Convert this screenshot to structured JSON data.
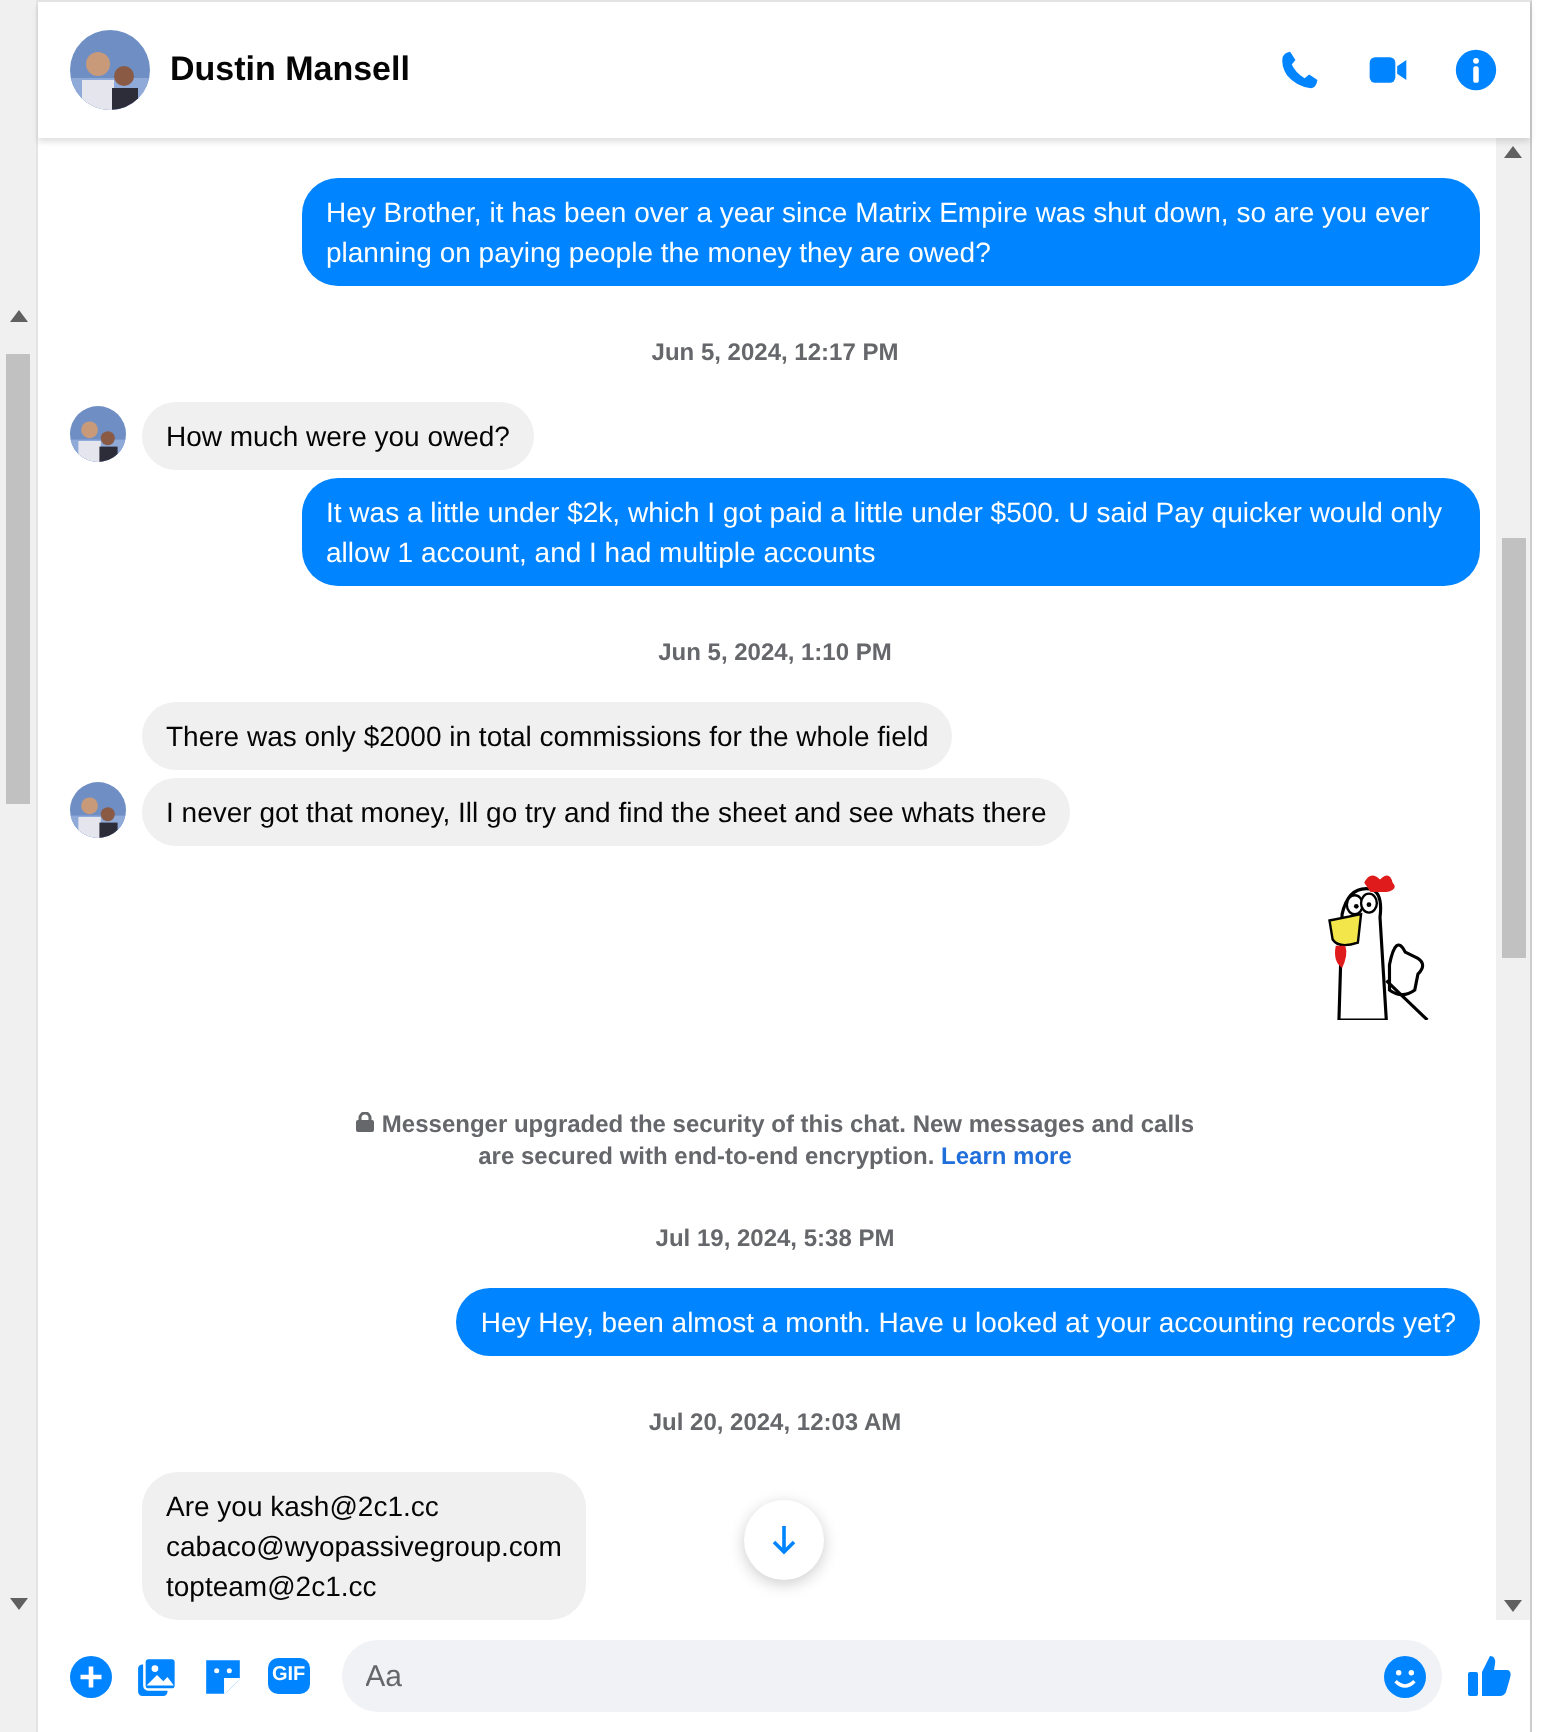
{
  "header": {
    "name": "Dustin Mansell"
  },
  "messages": [
    {
      "kind": "out",
      "text": "Hey Brother, it has been over a year since Matrix Empire was shut down, so are you ever planning on paying people the money they are owed?"
    },
    {
      "kind": "time",
      "text": "Jun 5, 2024, 12:17 PM"
    },
    {
      "kind": "in",
      "text": "How much were you owed?",
      "avatar": true
    },
    {
      "kind": "out",
      "text": "It was a little under $2k, which I got paid a little under $500. U said Pay quicker would only allow 1 account, and I had multiple accounts"
    },
    {
      "kind": "time",
      "text": "Jun 5, 2024, 1:10 PM"
    },
    {
      "kind": "in",
      "text": "There was only $2000 in total commissions for the whole field",
      "avatar": false
    },
    {
      "kind": "in",
      "text": "I never got that money, Ill go try and find the sheet and see whats there",
      "avatar": true
    },
    {
      "kind": "sticker"
    },
    {
      "kind": "notice",
      "text": "Messenger upgraded the security of this chat. New messages and calls are secured with end-to-end encryption.",
      "link": "Learn more"
    },
    {
      "kind": "time",
      "text": "Jul 19, 2024, 5:38 PM"
    },
    {
      "kind": "out",
      "text": "Hey Hey, been almost a month. Have u looked at your accounting records yet?"
    },
    {
      "kind": "time",
      "text": "Jul 20, 2024, 12:03 AM"
    },
    {
      "kind": "in",
      "text": "Are you kash@2c1.cc\ncabaco@wyopassivegroup.com\ntopteam@2c1.cc",
      "avatar": false
    }
  ],
  "composer": {
    "gif_label": "GIF",
    "placeholder": "Aa"
  }
}
